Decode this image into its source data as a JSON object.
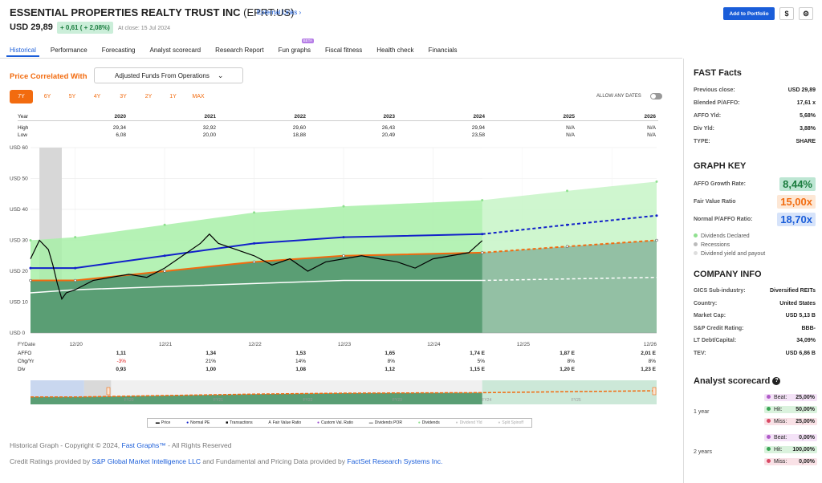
{
  "header": {
    "company": "ESSENTIAL PROPERTIES REALTY TRUST INC",
    "ticker": "(EPRT:US)",
    "external_links": "External Links",
    "price": "USD 29,89",
    "change": "+ 0,61 ( + 2,08%)",
    "at_close": "At close: 15 Jul 2024",
    "add_portfolio": "Add to Portfolio",
    "currency_btn": "$",
    "gear_icon": "gear-icon"
  },
  "tabs": [
    {
      "label": "Historical",
      "active": true
    },
    {
      "label": "Performance"
    },
    {
      "label": "Forecasting"
    },
    {
      "label": "Analyst scorecard"
    },
    {
      "label": "Research Report"
    },
    {
      "label": "Fun graphs",
      "badge": "BETA"
    },
    {
      "label": "Fiscal fitness"
    },
    {
      "label": "Health check"
    },
    {
      "label": "Financials"
    }
  ],
  "controls": {
    "price_correlated": "Price Correlated With",
    "dropdown": "Adjusted Funds From Operations",
    "ranges": [
      "7Y",
      "6Y",
      "5Y",
      "4Y",
      "3Y",
      "2Y",
      "1Y",
      "MAX"
    ],
    "allow_dates": "ALLOW ANY DATES"
  },
  "top_table": {
    "year_label": "Year",
    "high_label": "High",
    "low_label": "Low",
    "years": [
      "2020",
      "2021",
      "2022",
      "2023",
      "2024",
      "2025",
      "2026"
    ],
    "high": [
      "29,34",
      "32,92",
      "29,60",
      "26,43",
      "29,94",
      "N/A",
      "N/A"
    ],
    "low": [
      "6,08",
      "20,00",
      "18,88",
      "20,49",
      "23,58",
      "N/A",
      "N/A"
    ]
  },
  "chart_data": {
    "type": "line",
    "y_ticks": [
      "USD 60",
      "USD 50",
      "USD 40",
      "USD 30",
      "USD 20",
      "USD 10",
      "USD 0"
    ],
    "ylim": [
      0,
      60
    ],
    "x_ticks": [
      "12/20",
      "12/21",
      "12/22",
      "12/23",
      "12/24",
      "12/25",
      "12/26"
    ],
    "fydate_label": "FYDate",
    "price": [
      [
        2019.5,
        24
      ],
      [
        2019.6,
        30
      ],
      [
        2019.7,
        27
      ],
      [
        2019.75,
        22
      ],
      [
        2019.8,
        16
      ],
      [
        2019.85,
        11
      ],
      [
        2019.9,
        13
      ],
      [
        2020.0,
        14
      ],
      [
        2020.2,
        17
      ],
      [
        2020.4,
        18
      ],
      [
        2020.6,
        19
      ],
      [
        2020.8,
        18
      ],
      [
        2021.0,
        21
      ],
      [
        2021.2,
        25
      ],
      [
        2021.4,
        29
      ],
      [
        2021.5,
        32
      ],
      [
        2021.6,
        29
      ],
      [
        2021.8,
        27
      ],
      [
        2022.0,
        25
      ],
      [
        2022.2,
        22
      ],
      [
        2022.4,
        24
      ],
      [
        2022.6,
        20
      ],
      [
        2022.8,
        23
      ],
      [
        2023.0,
        24
      ],
      [
        2023.2,
        25
      ],
      [
        2023.4,
        24
      ],
      [
        2023.6,
        23
      ],
      [
        2023.8,
        21
      ],
      [
        2024.0,
        24
      ],
      [
        2024.2,
        25
      ],
      [
        2024.4,
        26
      ],
      [
        2024.55,
        29.89
      ]
    ],
    "normal_pe": [
      [
        2019.5,
        21
      ],
      [
        2020.0,
        21
      ],
      [
        2021.0,
        25
      ],
      [
        2022.0,
        29
      ],
      [
        2023.0,
        31
      ],
      [
        2024.55,
        32
      ],
      [
        2025.5,
        35
      ],
      [
        2026.5,
        38
      ]
    ],
    "fair_value": [
      [
        2019.5,
        17
      ],
      [
        2020.0,
        17
      ],
      [
        2021.0,
        20
      ],
      [
        2022.0,
        23
      ],
      [
        2023.0,
        25
      ],
      [
        2024.55,
        26
      ],
      [
        2025.5,
        28
      ],
      [
        2026.5,
        30
      ]
    ],
    "dividend_por": [
      [
        2019.5,
        13
      ],
      [
        2020.0,
        14
      ],
      [
        2021.0,
        15
      ],
      [
        2022.0,
        16
      ],
      [
        2023.0,
        17
      ],
      [
        2024.55,
        17
      ],
      [
        2025.5,
        17.5
      ],
      [
        2026.5,
        18
      ]
    ],
    "dividends_band": [
      [
        2019.5,
        30
      ],
      [
        2020.0,
        31
      ],
      [
        2021.0,
        35
      ],
      [
        2022.0,
        39
      ],
      [
        2023.0,
        41
      ],
      [
        2024.55,
        43
      ],
      [
        2025.5,
        46
      ],
      [
        2026.5,
        49
      ]
    ],
    "legend": [
      "Price",
      "Normal PE",
      "Transactions",
      "Fair Value Ratio",
      "Custom Val. Ratio",
      "Dividends POR",
      "Dividends",
      "Dividend Yld",
      "Split Spinoff"
    ],
    "colors": {
      "price": "#000000",
      "normal_pe": "#1221c9",
      "fair_value": "#f26b0f",
      "dividend": "#ffffff",
      "band_light": "#a8f0a8",
      "band_dark": "#5a9e74"
    }
  },
  "bottom_table": {
    "affo_label": "AFFO",
    "chg_label": "Chg/Yr",
    "div_label": "Div",
    "affo": [
      "1,11",
      "1,34",
      "1,53",
      "1,65",
      "1,74 E",
      "1,87 E",
      "2,01 E"
    ],
    "chg": [
      "-3%",
      "21%",
      "14%",
      "8%",
      "5%",
      "8%",
      "8%"
    ],
    "div": [
      "0,93",
      "1,00",
      "1,08",
      "1,12",
      "1,15 E",
      "1,20 E",
      "1,23 E"
    ]
  },
  "mini_x": [
    "FY20",
    "FY21",
    "FY22",
    "FY23",
    "FY24",
    "FY25",
    "FY26"
  ],
  "footer": {
    "copy1": "Historical Graph - Copyright © 2024, ",
    "fastgraphs": "Fast Graphs™",
    "copy2": " - All Rights Reserved",
    "credit1": "Credit Ratings provided by ",
    "sp": "S&P Global Market Intelligence LLC",
    "credit2": " and Fundamental and Pricing Data provided by ",
    "factset": "FactSet Research Systems Inc."
  },
  "fast_facts": {
    "title": "FAST Facts",
    "rows": [
      {
        "k": "Previous close:",
        "v": "USD 29,89"
      },
      {
        "k": "Blended P/AFFO:",
        "v": "17,61 x"
      },
      {
        "k": "AFFO Yld:",
        "v": "5,68%"
      },
      {
        "k": "Div Yld:",
        "v": "3,88%"
      },
      {
        "k": "TYPE:",
        "v": "SHARE"
      }
    ]
  },
  "graph_key": {
    "title": "GRAPH KEY",
    "rows": [
      {
        "k": "AFFO Growth Rate:",
        "v": "8,44%",
        "bg": "#bde6d3",
        "fg": "#1a7c3e"
      },
      {
        "k": "Fair Value Ratio",
        "v": "15,00x",
        "bg": "#fde7d5",
        "fg": "#f26b0f"
      },
      {
        "k": "Normal P/AFFO Ratio:",
        "v": "18,70x",
        "bg": "#d6e3fa",
        "fg": "#1a5dd9"
      }
    ],
    "legend": [
      {
        "label": "Dividends Declared",
        "color": "#8fe08f"
      },
      {
        "label": "Recessions",
        "color": "#bbbbbb"
      },
      {
        "label": "Dividend yield and payout",
        "color": "#dddddd"
      }
    ]
  },
  "company_info": {
    "title": "COMPANY INFO",
    "rows": [
      {
        "k": "GICS Sub-industry:",
        "v": "Diversified REITs"
      },
      {
        "k": "Country:",
        "v": "United States"
      },
      {
        "k": "Market Cap:",
        "v": "USD 5,13 B"
      },
      {
        "k": "S&P Credit Rating:",
        "v": "BBB-"
      },
      {
        "k": "LT Debt/Capital:",
        "v": "34,09%"
      },
      {
        "k": "TEV:",
        "v": "USD 6,86 B"
      }
    ]
  },
  "analyst": {
    "title": "Analyst scorecard",
    "p1": "1 year",
    "p2": "2 years",
    "y1": [
      {
        "k": "Beat:",
        "v": "25,00%"
      },
      {
        "k": "Hit:",
        "v": "50,00%"
      },
      {
        "k": "Miss:",
        "v": "25,00%"
      }
    ],
    "y2": [
      {
        "k": "Beat:",
        "v": "0,00%"
      },
      {
        "k": "Hit:",
        "v": "100,00%"
      },
      {
        "k": "Miss:",
        "v": "0,00%"
      }
    ]
  }
}
